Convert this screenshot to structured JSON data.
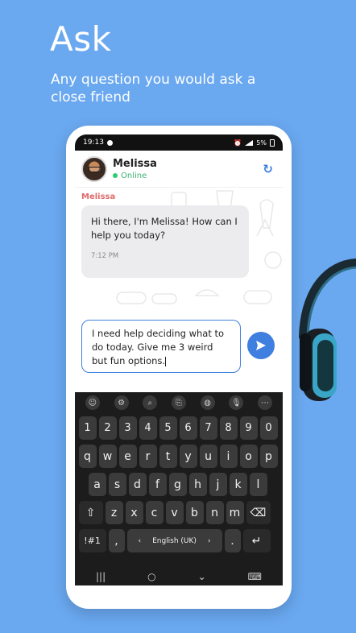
{
  "hero": {
    "title": "Ask",
    "subtitle": "Any question you would ask a close friend"
  },
  "statusbar": {
    "time": "19:13",
    "battery": "5%"
  },
  "chat": {
    "contact_name": "Melissa",
    "contact_status": "Online",
    "sender_label": "Melissa",
    "messages": [
      {
        "text": "Hi there, I'm Melissa! How can I help you today?",
        "time": "7:12 PM"
      }
    ],
    "input_value": "I need help deciding what to do today. Give me 3 weird but fun options."
  },
  "keyboard": {
    "row_numbers": [
      "1",
      "2",
      "3",
      "4",
      "5",
      "6",
      "7",
      "8",
      "9",
      "0"
    ],
    "row_1": [
      "q",
      "w",
      "e",
      "r",
      "t",
      "y",
      "u",
      "i",
      "o",
      "p"
    ],
    "row_2": [
      "a",
      "s",
      "d",
      "f",
      "g",
      "h",
      "j",
      "k",
      "l"
    ],
    "row_3": [
      "z",
      "x",
      "c",
      "v",
      "b",
      "n",
      "m"
    ],
    "symbols_label": "!#1",
    "comma_label": ",",
    "space_label": "English (UK)",
    "period_label": "."
  },
  "colors": {
    "background": "#6aa8f0",
    "accent": "#3f7fe0",
    "online": "#2ecc71",
    "sender_label": "#e06a6a"
  }
}
